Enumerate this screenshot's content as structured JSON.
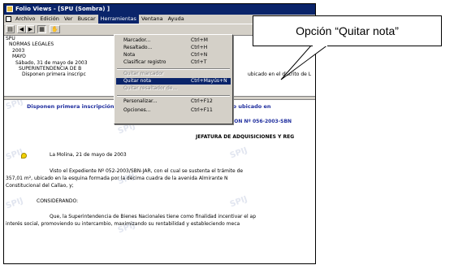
{
  "window": {
    "title": "Folio Views - [SPU (Sombra) ]"
  },
  "menubar": {
    "items": [
      {
        "label": "Archivo"
      },
      {
        "label": "Edición"
      },
      {
        "label": "Ver"
      },
      {
        "label": "Buscar"
      },
      {
        "label": "Herramientas"
      },
      {
        "label": "Ventana"
      },
      {
        "label": "Ayuda"
      }
    ]
  },
  "toolbar": {
    "buttons": [
      "print-icon",
      "back-icon",
      "forward-icon",
      "contents-icon",
      "hand-icon"
    ]
  },
  "tree": {
    "lines": [
      "SPU",
      "NORMAS LEGALES",
      "2003",
      "MAYO",
      "Sábado, 31 de mayo de 2003",
      "SUPERINTENDENCIA DE B",
      "Disponen primera inscripc"
    ],
    "tail": "ubicado en el distrito de L"
  },
  "dropdown": {
    "items": [
      {
        "label": "Marcador...",
        "shortcut": "Ctrl+M"
      },
      {
        "label": "Resaltado...",
        "shortcut": "Ctrl+H"
      },
      {
        "label": "Nota",
        "shortcut": "Ctrl+N"
      },
      {
        "label": "Clasificar registro",
        "shortcut": "Ctrl+T"
      },
      {
        "label": "Quitar marcador"
      },
      {
        "label": "Quitar nota",
        "shortcut": "Ctrl+Mayús+N"
      },
      {
        "label": "Quitar resaltador de..."
      },
      {
        "label": "Personalizar...",
        "shortcut": "Ctrl+F12"
      },
      {
        "label": "Opciones...",
        "shortcut": "Ctrl+F11"
      }
    ]
  },
  "document": {
    "heading": "Disponen primera inscripción de dominio a favor de Estado de terreno ubicado en",
    "resolution": "RESOLUCION Nº 056-2003-SBN",
    "jefatura": "JEFATURA DE ADQUISICIONES Y REG",
    "date": "La Molina, 21 de mayo de 2003",
    "para1_line1": "Visto el Expediente Nº 052-2003/SBN-JAR, con el cual se sustenta el trámite de",
    "para1_line2": "357,01 m², ubicado en la esquina formada por la décima cuadra de la avenida Almirante N",
    "para1_line3": "Constitucional del Callao, y;",
    "considerando": "CONSIDERANDO:",
    "para2_line1": "Que, la Superintendencia de Bienes Nacionales tiene como finalidad incentivar el ap",
    "para2_line2": "interés social, promoviendo su intercambio, maximizando su rentabilidad y estableciendo meca",
    "watermark": "SPIJ"
  },
  "callout": {
    "text": "Opción “Quitar nota”"
  },
  "colors": {
    "titlebar": "#0a246a",
    "highlight": "#0a246a",
    "doc_heading": "#1f2e9e",
    "face": "#d4d0c8"
  }
}
